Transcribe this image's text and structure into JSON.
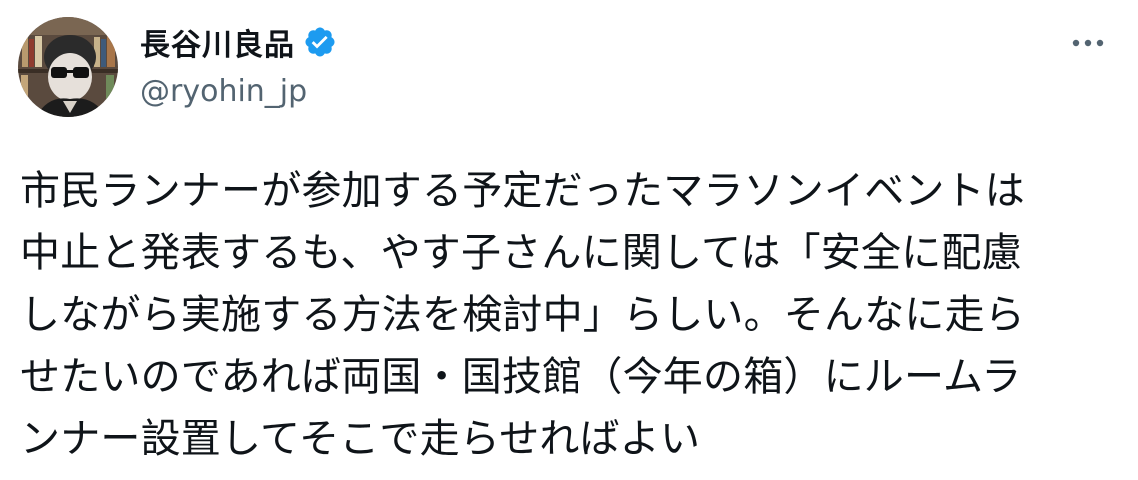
{
  "tweet": {
    "author": {
      "display_name": "長谷川良品",
      "handle": "@ryohin_jp",
      "verified": true,
      "avatar_icon": "user-avatar-photo"
    },
    "more_icon": "more-horizontal-icon",
    "text": "市民ランナーが参加する予定だったマラソンイベントは\n中止と発表するも、やす子さんに関しては「安全に配慮\nしながら実施する方法を検討中」らしい。そんなに走ら\nせたいのであれば両国・国技館（今年の箱）にルームラ\nンナー設置してそこで走らせればよい"
  },
  "colors": {
    "text_primary": "#0f1419",
    "text_secondary": "#536471",
    "verified_blue": "#1d9bf0",
    "background": "#ffffff"
  }
}
